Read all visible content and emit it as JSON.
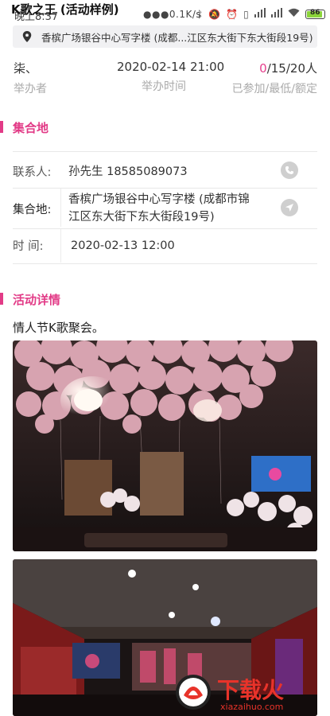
{
  "status_bar": {
    "time": "晚上8:37",
    "net_speed": "0.1K/s",
    "battery": "86"
  },
  "app_title": "K歌之王 (活动样例)",
  "address_bar": {
    "text": "香槟广场银谷中心写字楼 (成都...江区东大街下东大街段19号)"
  },
  "summary": {
    "host_value": "柒、",
    "host_label": "举办者",
    "time_value": "2020-02-14 21:00",
    "time_label": "举办时间",
    "joined": "0",
    "rest": "/15/20人",
    "count_label": "已参加/最低/额定"
  },
  "meeting": {
    "section_title": "集合地",
    "contact_label": "联系人:",
    "contact_value": "孙先生 18585089073",
    "place_label": "集合地:",
    "place_value_line1": "香槟广场银谷中心写字楼 (成都市锦",
    "place_value_line2": "江区东大街下东大街段19号)",
    "time_label": "时    间:",
    "time_value": "2020-02-13 12:00"
  },
  "details": {
    "section_title": "活动详情",
    "description": "情人节K歌聚会。"
  },
  "watermark": {
    "brand": "下载火",
    "domain": "xiazaihuo.com"
  },
  "colors": {
    "accent": "#e23b87",
    "battery": "#8bd43b"
  }
}
